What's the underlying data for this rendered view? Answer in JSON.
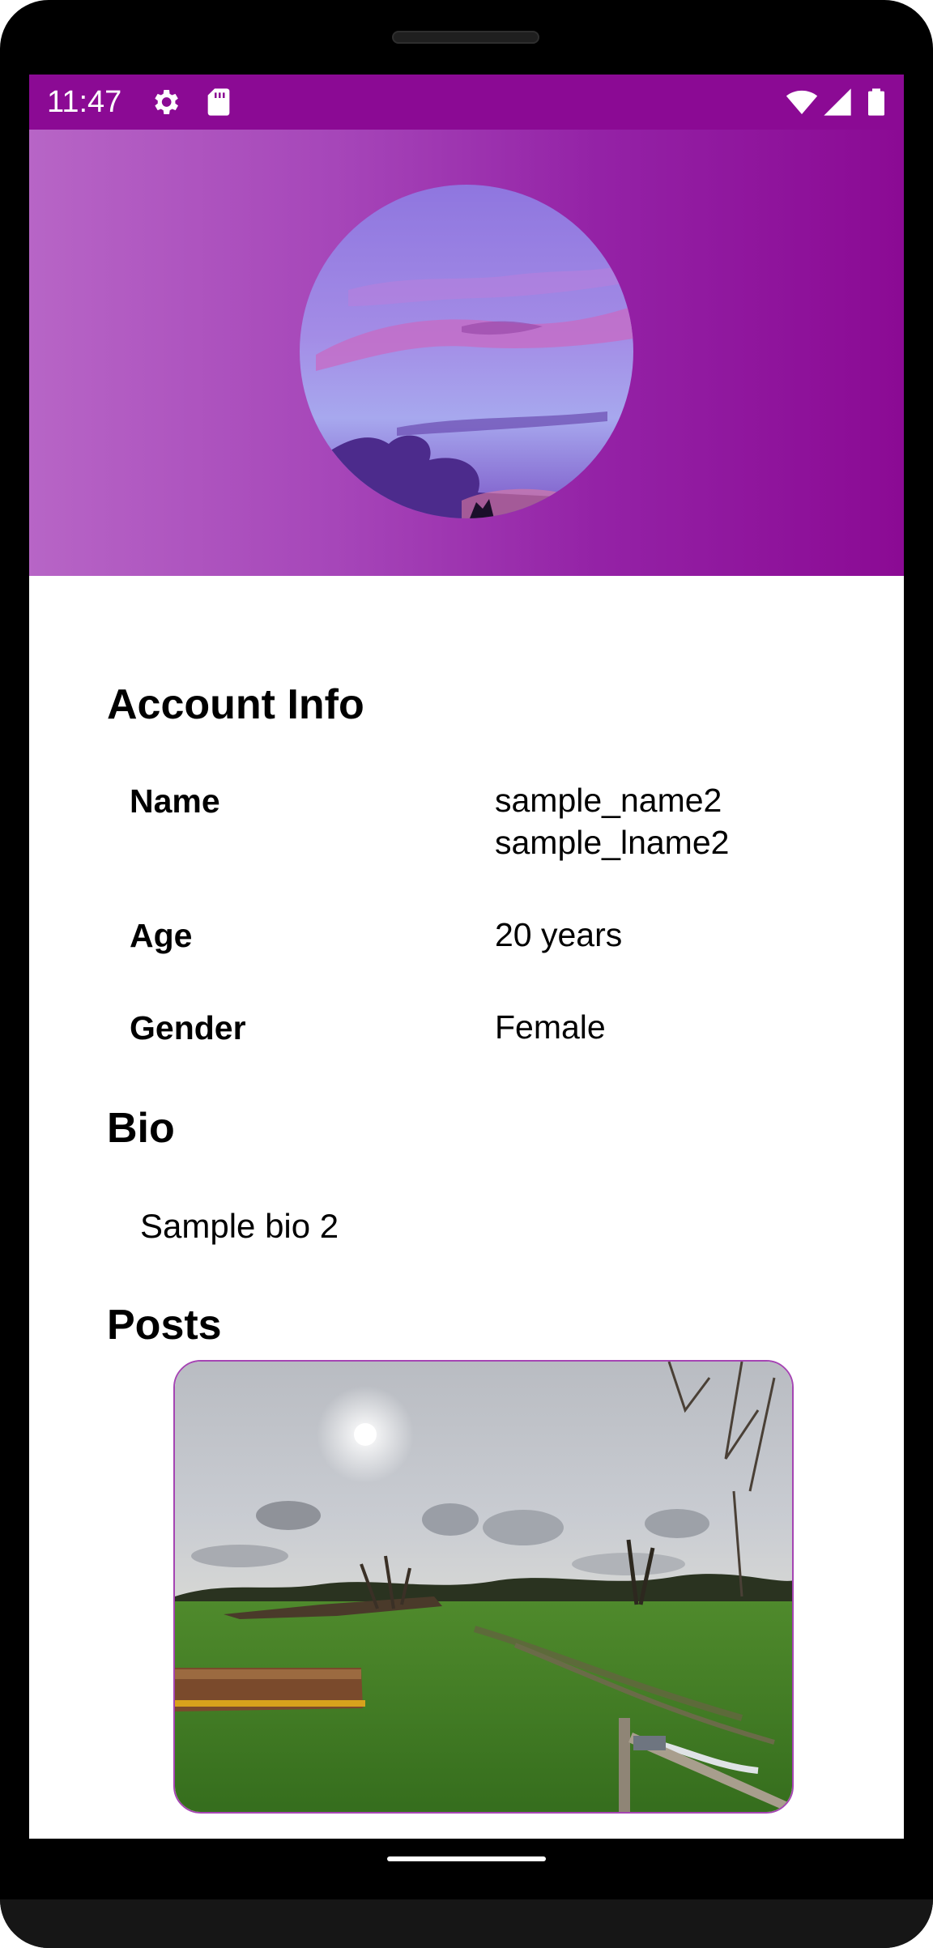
{
  "status_bar": {
    "time": "11:47",
    "icons": [
      "settings-icon",
      "sd-card-icon",
      "wifi-icon",
      "signal-icon",
      "battery-icon"
    ],
    "background": "#8b0a94"
  },
  "header": {
    "gradient_start": "#b765c6",
    "gradient_end": "#8b0a94",
    "avatar_image": "sunset-sky-photo"
  },
  "account_info": {
    "title": "Account Info",
    "rows": [
      {
        "label": "Name",
        "value_line1": "sample_name2",
        "value_line2": "sample_lname2"
      },
      {
        "label": "Age",
        "value_line1": "20 years"
      },
      {
        "label": "Gender",
        "value_line1": "Female"
      }
    ]
  },
  "bio": {
    "title": "Bio",
    "text": "Sample bio 2"
  },
  "posts": {
    "title": "Posts",
    "items": [
      {
        "image": "field-landscape-photo"
      }
    ]
  }
}
